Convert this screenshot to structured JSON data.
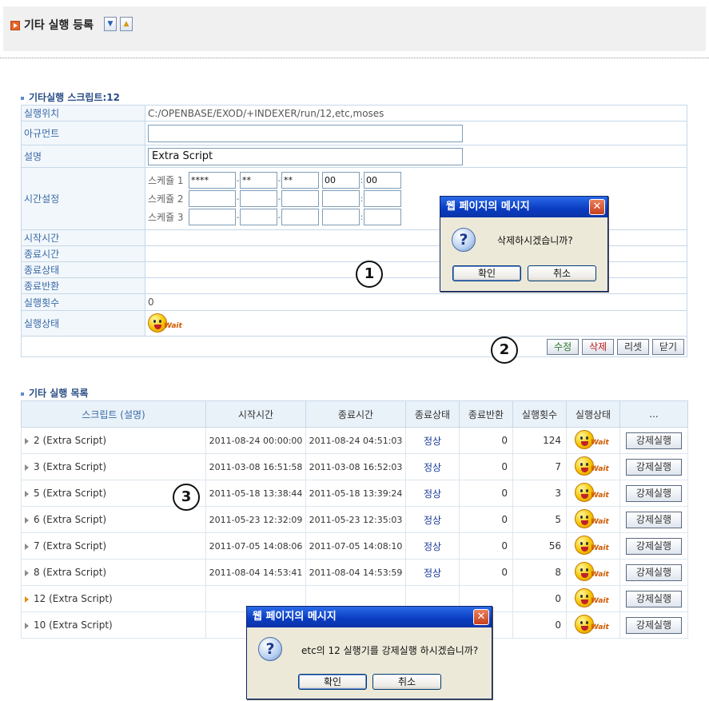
{
  "header": {
    "title": "기타 실행 등록",
    "collapse_icon": "▼",
    "expand_icon": "▲"
  },
  "form": {
    "section_title": "기타실행 스크립트:12",
    "labels": {
      "location": "실행위치",
      "argument": "아규먼트",
      "description": "설명",
      "time_setting": "시간설정",
      "start_time": "시작시간",
      "end_time": "종료시간",
      "end_status": "종료상태",
      "end_return": "종료반환",
      "run_count": "실행횟수",
      "run_state": "실행상태"
    },
    "location_value": "C:/OPENBASE/EXOD/+INDEXER/run/12,etc,moses",
    "argument_value": "",
    "description_value": "Extra Script",
    "schedules": [
      {
        "label": "스케쥴 1",
        "year": "****",
        "month": "**",
        "day": "**",
        "hour": "00",
        "minute": "00"
      },
      {
        "label": "스케쥴 2",
        "year": "",
        "month": "",
        "day": "",
        "hour": "",
        "minute": ""
      },
      {
        "label": "스케쥴 3",
        "year": "",
        "month": "",
        "day": "",
        "hour": "",
        "minute": ""
      }
    ],
    "start_time_value": "",
    "end_time_value": "",
    "end_status_value": "",
    "end_return_value": "",
    "run_count_value": "0",
    "run_state_value": "Wait",
    "buttons": {
      "edit": "수정",
      "delete": "삭제",
      "reset": "리셋",
      "close": "닫기"
    }
  },
  "markers": {
    "m1": "1",
    "m2": "2",
    "m3": "3"
  },
  "list": {
    "section_title": "기타 실행 목록",
    "columns": [
      "스크립트 (설명)",
      "시작시간",
      "종료시간",
      "종료상태",
      "종료반환",
      "실행횟수",
      "실행상태",
      "..."
    ],
    "rows": [
      {
        "script": "2 (Extra Script)",
        "start": "2011-08-24 00:00:00",
        "end": "2011-08-24 04:51:03",
        "status": "정상",
        "ret": "0",
        "count": "124",
        "state": "Wait",
        "action": "강제실행",
        "active": false
      },
      {
        "script": "3 (Extra Script)",
        "start": "2011-03-08 16:51:58",
        "end": "2011-03-08 16:52:03",
        "status": "정상",
        "ret": "0",
        "count": "7",
        "state": "Wait",
        "action": "강제실행",
        "active": false
      },
      {
        "script": "5 (Extra Script)",
        "start": "2011-05-18 13:38:44",
        "end": "2011-05-18 13:39:24",
        "status": "정상",
        "ret": "0",
        "count": "3",
        "state": "Wait",
        "action": "강제실행",
        "active": false
      },
      {
        "script": "6 (Extra Script)",
        "start": "2011-05-23 12:32:09",
        "end": "2011-05-23 12:35:03",
        "status": "정상",
        "ret": "0",
        "count": "5",
        "state": "Wait",
        "action": "강제실행",
        "active": false
      },
      {
        "script": "7 (Extra Script)",
        "start": "2011-07-05 14:08:06",
        "end": "2011-07-05 14:08:10",
        "status": "정상",
        "ret": "0",
        "count": "56",
        "state": "Wait",
        "action": "강제실행",
        "active": false
      },
      {
        "script": "8 (Extra Script)",
        "start": "2011-08-04 14:53:41",
        "end": "2011-08-04 14:53:59",
        "status": "정상",
        "ret": "0",
        "count": "8",
        "state": "Wait",
        "action": "강제실행",
        "active": false
      },
      {
        "script": "12 (Extra Script)",
        "start": "",
        "end": "",
        "status": "",
        "ret": "",
        "count": "0",
        "state": "Wait",
        "action": "강제실행",
        "active": true
      },
      {
        "script": "10 (Extra Script)",
        "start": "",
        "end": "",
        "status": "",
        "ret": "",
        "count": "0",
        "state": "Wait",
        "action": "강제실행",
        "active": false
      }
    ]
  },
  "dialog_delete": {
    "title": "웹 페이지의 메시지",
    "message": "삭제하시겠습니까?",
    "ok": "확인",
    "cancel": "취소",
    "close": "✕",
    "icon": "?"
  },
  "dialog_force": {
    "title": "웹 페이지의 메시지",
    "message": "etc의 12 실행기를 강제실행 하시겠습니까?",
    "ok": "확인",
    "cancel": "취소",
    "close": "✕",
    "icon": "?"
  }
}
